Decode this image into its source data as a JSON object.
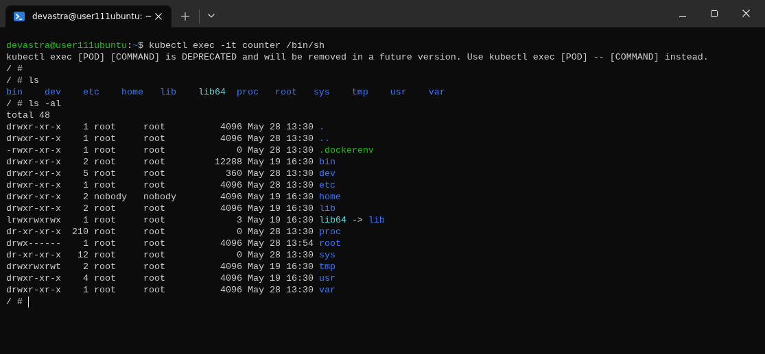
{
  "window": {
    "tab": {
      "title": "devastra@user111ubuntu: ~",
      "selected": true
    }
  },
  "terminal": {
    "lines": [
      {
        "kind": "plain",
        "segs": [
          {
            "kind": "user",
            "text": "devastra@user111ubuntu"
          },
          {
            "kind": "text",
            "text": ":"
          },
          {
            "kind": "path",
            "text": "~"
          },
          {
            "kind": "text",
            "text": "$ kubectl exec -it counter /bin/sh"
          }
        ]
      },
      {
        "kind": "plain",
        "segs": [
          {
            "kind": "text",
            "text": "kubectl exec [POD] [COMMAND] is DEPRECATED and will be removed in a future version. Use kubectl exec [POD] -- [COMMAND] instead."
          }
        ]
      },
      {
        "kind": "plain",
        "segs": [
          {
            "kind": "text",
            "text": "/ #"
          }
        ]
      },
      {
        "kind": "plain",
        "segs": [
          {
            "kind": "text",
            "text": "/ # ls"
          }
        ]
      },
      {
        "kind": "columns",
        "segs": [
          {
            "kind": "dir",
            "text": "bin"
          },
          {
            "kind": "dir",
            "text": "dev"
          },
          {
            "kind": "dir",
            "text": "etc"
          },
          {
            "kind": "dir",
            "text": "home"
          },
          {
            "kind": "dir",
            "text": "lib"
          },
          {
            "kind": "link",
            "text": "lib64"
          },
          {
            "kind": "dir",
            "text": "proc"
          },
          {
            "kind": "dir",
            "text": "root"
          },
          {
            "kind": "dir",
            "text": "sys"
          },
          {
            "kind": "dir",
            "text": "tmp"
          },
          {
            "kind": "dir",
            "text": "usr"
          },
          {
            "kind": "dir",
            "text": "var"
          }
        ]
      },
      {
        "kind": "plain",
        "segs": [
          {
            "kind": "text",
            "text": "/ # ls -al"
          }
        ]
      },
      {
        "kind": "plain",
        "segs": [
          {
            "kind": "text",
            "text": "total 48"
          }
        ]
      },
      {
        "kind": "spaced",
        "segs": [
          {
            "kind": "text",
            "text": "drwxr-xr-x    1 root     root          4096 May 28 13:30"
          },
          {
            "kind": "dir",
            "text": "."
          }
        ]
      },
      {
        "kind": "spaced",
        "segs": [
          {
            "kind": "text",
            "text": "drwxr-xr-x    1 root     root          4096 May 28 13:30"
          },
          {
            "kind": "dir",
            "text": ".."
          }
        ]
      },
      {
        "kind": "spaced",
        "segs": [
          {
            "kind": "text",
            "text": "-rwxr-xr-x    1 root     root             0 May 28 13:30"
          },
          {
            "kind": "exec",
            "text": ".dockerenv"
          }
        ]
      },
      {
        "kind": "spaced",
        "segs": [
          {
            "kind": "text",
            "text": "drwxr-xr-x    2 root     root         12288 May 19 16:30"
          },
          {
            "kind": "dir",
            "text": "bin"
          }
        ]
      },
      {
        "kind": "spaced",
        "segs": [
          {
            "kind": "text",
            "text": "drwxr-xr-x    5 root     root           360 May 28 13:30"
          },
          {
            "kind": "dir",
            "text": "dev"
          }
        ]
      },
      {
        "kind": "spaced",
        "segs": [
          {
            "kind": "text",
            "text": "drwxr-xr-x    1 root     root          4096 May 28 13:30"
          },
          {
            "kind": "dir",
            "text": "etc"
          }
        ]
      },
      {
        "kind": "spaced",
        "segs": [
          {
            "kind": "text",
            "text": "drwxr-xr-x    2 nobody   nobody        4096 May 19 16:30"
          },
          {
            "kind": "dir",
            "text": "home"
          }
        ]
      },
      {
        "kind": "spaced",
        "segs": [
          {
            "kind": "text",
            "text": "drwxr-xr-x    2 root     root          4096 May 19 16:30"
          },
          {
            "kind": "dir",
            "text": "lib"
          }
        ]
      },
      {
        "kind": "spaced",
        "segs": [
          {
            "kind": "text",
            "text": "lrwxrwxrwx    1 root     root             3 May 19 16:30"
          },
          {
            "kind": "link",
            "text": "lib64"
          },
          {
            "kind": "text",
            "text": "->"
          },
          {
            "kind": "dir",
            "text": "lib"
          }
        ]
      },
      {
        "kind": "spaced",
        "segs": [
          {
            "kind": "text",
            "text": "dr-xr-xr-x  210 root     root             0 May 28 13:30"
          },
          {
            "kind": "dir",
            "text": "proc"
          }
        ]
      },
      {
        "kind": "spaced",
        "segs": [
          {
            "kind": "text",
            "text": "drwx------    1 root     root          4096 May 28 13:54"
          },
          {
            "kind": "dir",
            "text": "root"
          }
        ]
      },
      {
        "kind": "spaced",
        "segs": [
          {
            "kind": "text",
            "text": "dr-xr-xr-x   12 root     root             0 May 28 13:30"
          },
          {
            "kind": "dir",
            "text": "sys"
          }
        ]
      },
      {
        "kind": "spaced",
        "segs": [
          {
            "kind": "text",
            "text": "drwxrwxrwt    2 root     root          4096 May 19 16:30"
          },
          {
            "kind": "dir",
            "text": "tmp"
          }
        ]
      },
      {
        "kind": "spaced",
        "segs": [
          {
            "kind": "text",
            "text": "drwxr-xr-x    4 root     root          4096 May 19 16:30"
          },
          {
            "kind": "dir",
            "text": "usr"
          }
        ]
      },
      {
        "kind": "spaced",
        "segs": [
          {
            "kind": "text",
            "text": "drwxr-xr-x    1 root     root          4096 May 28 13:30"
          },
          {
            "kind": "dir",
            "text": "var"
          }
        ]
      },
      {
        "kind": "spaced",
        "segs": [
          {
            "kind": "text",
            "text": "/ #"
          }
        ]
      }
    ]
  }
}
